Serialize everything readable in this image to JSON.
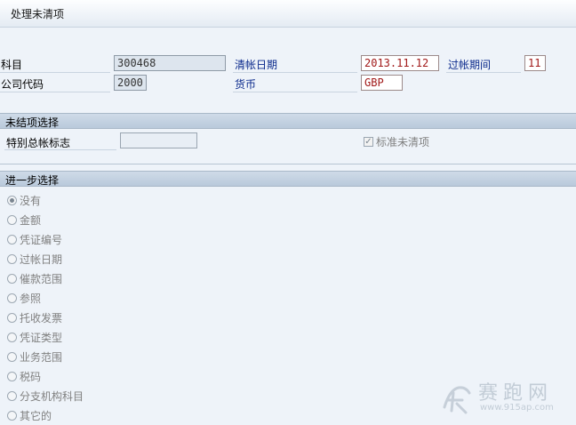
{
  "window": {
    "title": "处理未清项"
  },
  "header": {
    "account_label": "科目",
    "account_value": "300468",
    "company_label": "公司代码",
    "company_value": "2000",
    "clearing_date_label": "清帐日期",
    "clearing_date_value": "2013.11.12",
    "period_label": "过帐期间",
    "period_value": "11",
    "currency_label": "货币",
    "currency_value": "GBP"
  },
  "open_item_section": {
    "title": "未结项选择",
    "special_gl_label": "特别总帐标志",
    "special_gl_value": "",
    "standard_oi_label": "标准未清项",
    "standard_oi_checked": true
  },
  "further_selection": {
    "title": "进一步选择",
    "options": [
      {
        "label": "没有",
        "selected": true
      },
      {
        "label": "金额",
        "selected": false
      },
      {
        "label": "凭证编号",
        "selected": false
      },
      {
        "label": "过帐日期",
        "selected": false
      },
      {
        "label": "催款范围",
        "selected": false
      },
      {
        "label": "参照",
        "selected": false
      },
      {
        "label": "托收发票",
        "selected": false
      },
      {
        "label": "凭证类型",
        "selected": false
      },
      {
        "label": "业务范围",
        "selected": false
      },
      {
        "label": "税码",
        "selected": false
      },
      {
        "label": "分支机构科目",
        "selected": false
      },
      {
        "label": "其它的",
        "selected": false
      }
    ]
  },
  "watermark": {
    "text": "赛跑网",
    "url": "www.915ap.com"
  }
}
